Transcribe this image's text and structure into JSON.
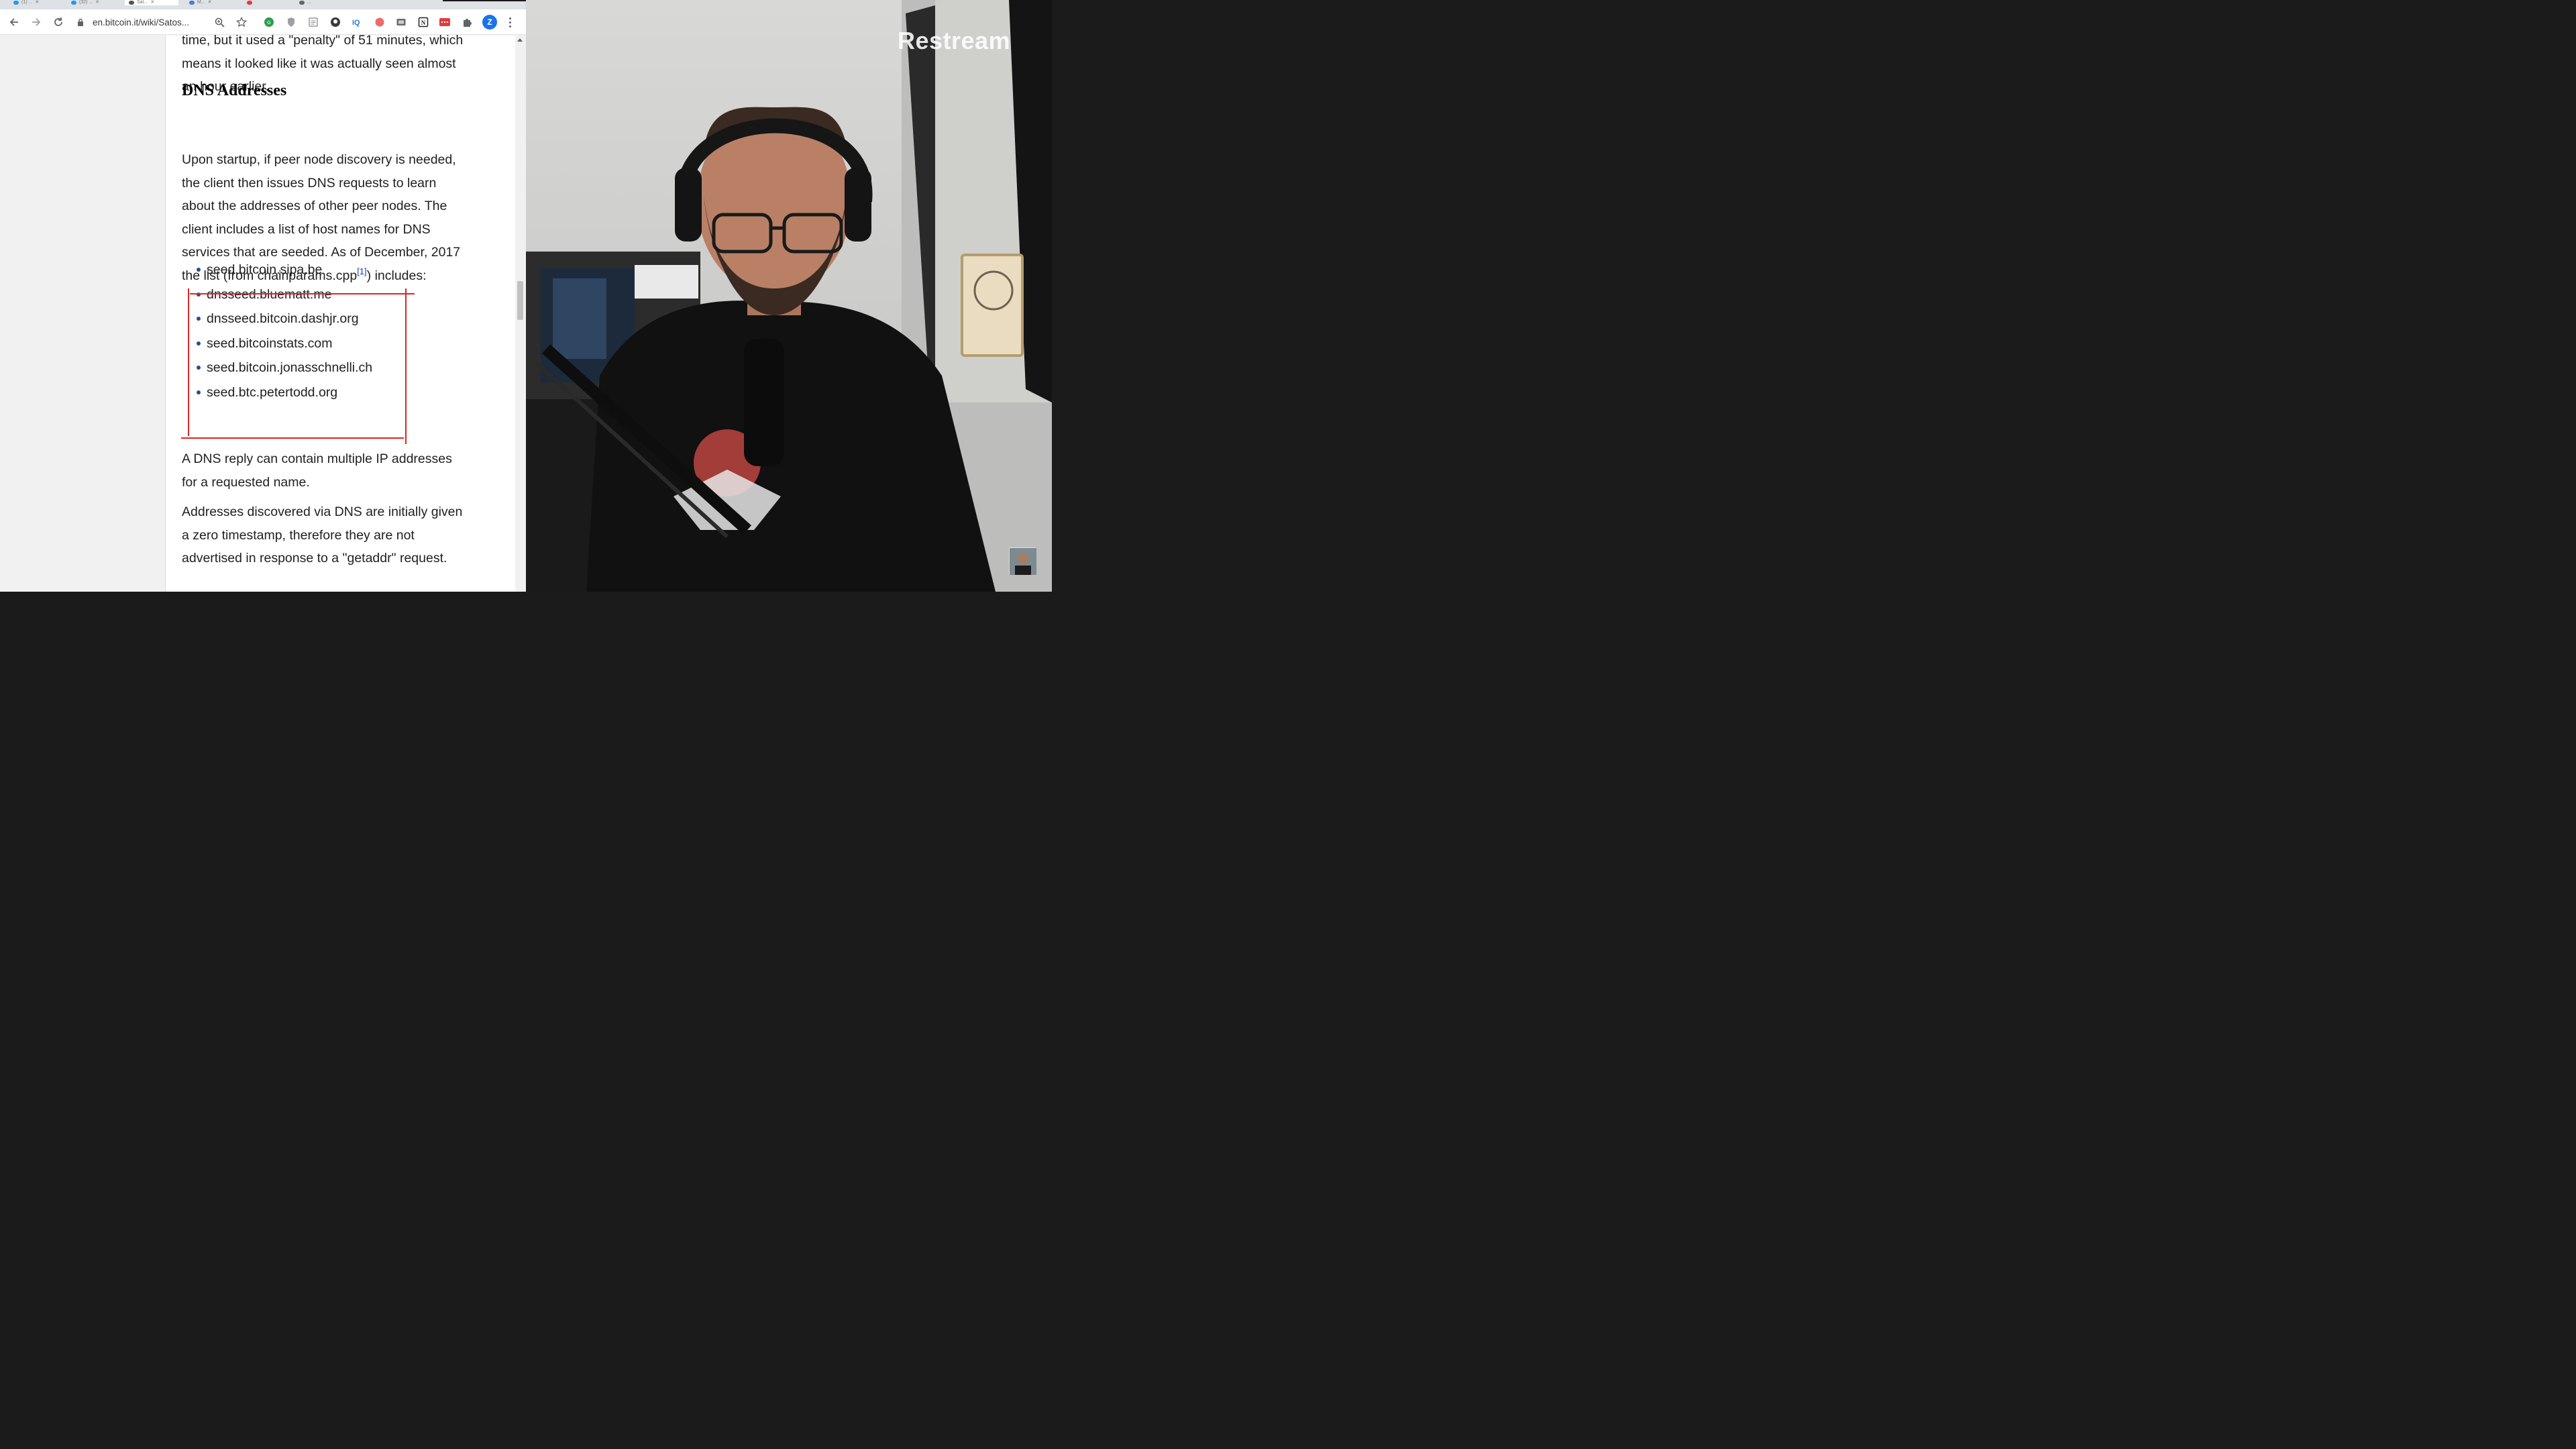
{
  "browser": {
    "tabs": [
      {
        "label": "(1) ..."
      },
      {
        "label": "(32) ..."
      },
      {
        "label": "Sat..."
      },
      {
        "label": "M..."
      },
      {
        "label": ""
      },
      {
        "label": "..."
      }
    ],
    "url": "en.bitcoin.it/wiki/Satos...",
    "profile_initial": "Z",
    "extensions": [
      "green-badge-icon",
      "shield-icon",
      "reader-icon",
      "github-icon",
      "iq-icon",
      "red-circle-icon",
      "screenshot-icon",
      "notion-icon",
      "red-extension-icon",
      "puzzle-icon"
    ]
  },
  "article": {
    "intro_lines": [
      "time, but it used a \"penalty\" of 51 minutes, which",
      "means it looked like it was actually seen almost",
      "an hour earlier."
    ],
    "heading": "DNS Addresses",
    "para1_lines": [
      "Upon startup, if peer node discovery is needed,",
      "the client then issues DNS requests to learn",
      "about the addresses of other peer nodes. The",
      "client includes a list of host names for DNS",
      "services that are seeded. As of December, 2017"
    ],
    "para1_last_before": "the list (from chainparams.cpp",
    "para1_ref": "[1]",
    "para1_last_after": ") includes:",
    "seeds": [
      "seed.bitcoin.sipa.be",
      "dnsseed.bluematt.me",
      "dnsseed.bitcoin.dashjr.org",
      "seed.bitcoinstats.com",
      "seed.bitcoin.jonasschnelli.ch",
      "seed.btc.petertodd.org"
    ],
    "para2_lines": [
      "A DNS reply can contain multiple IP addresses",
      "for a requested name."
    ],
    "para3_lines": [
      "Addresses discovered via DNS are initially given",
      "a zero timestamp, therefore they are not",
      "advertised in response to a \"getaddr\" request."
    ]
  },
  "stream": {
    "logo": "Restream"
  },
  "colors": {
    "annotation_red": "#e02424",
    "link_blue": "#0645ad",
    "profile_blue": "#1a73e8"
  }
}
